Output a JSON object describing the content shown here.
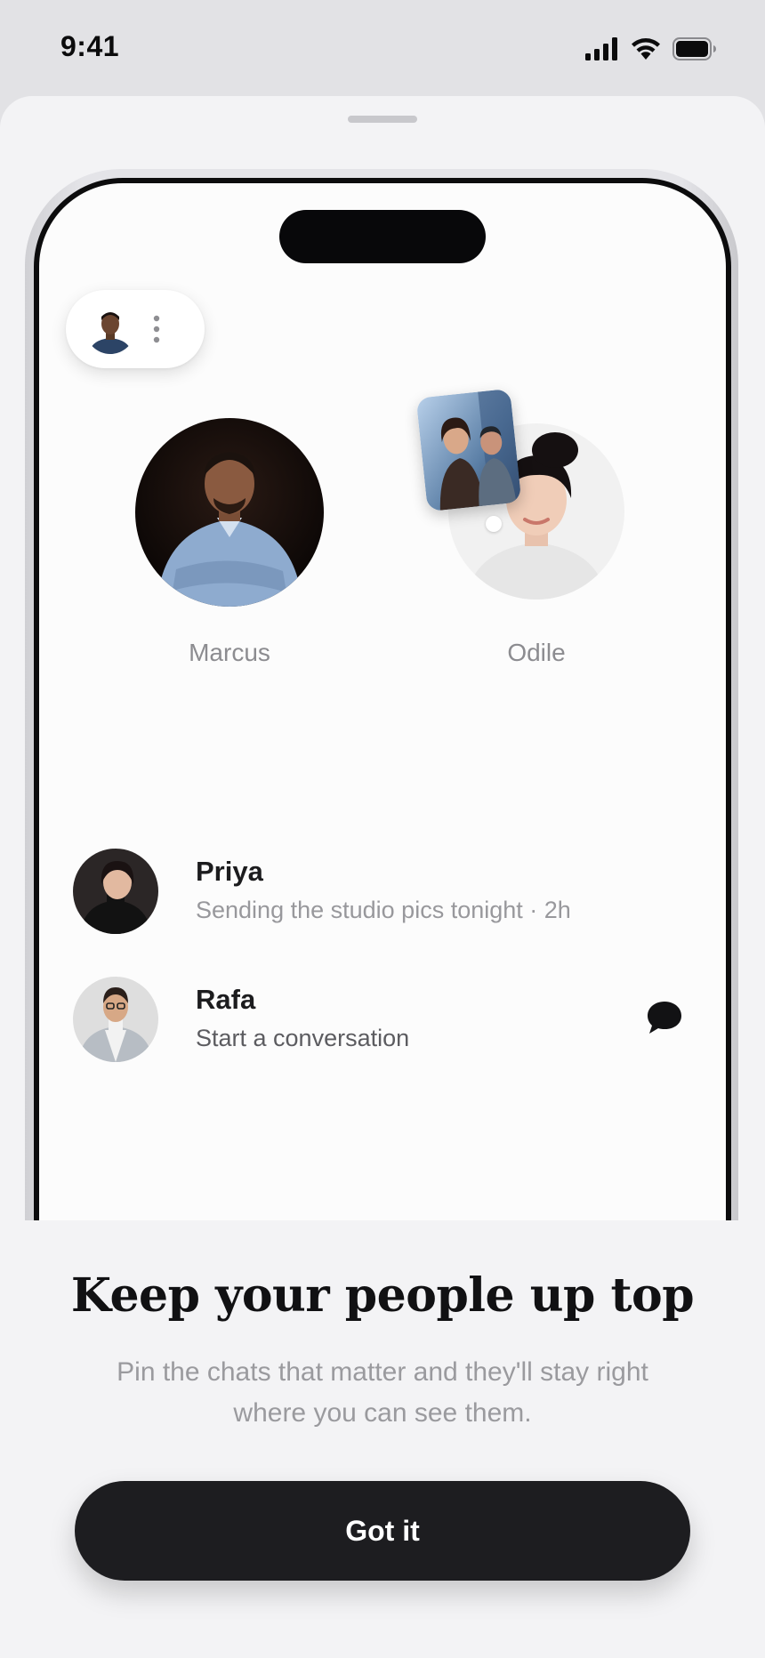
{
  "status_bar": {
    "time": "9:41"
  },
  "pinned": [
    {
      "name": "Marcus"
    },
    {
      "name": "Odile"
    }
  ],
  "chats": [
    {
      "name": "Priya",
      "preview": "Sending the studio pics tonight · 2h"
    },
    {
      "name": "Rafa",
      "preview": "Start a conversation"
    }
  ],
  "onboarding": {
    "title": "Keep your people up top",
    "description": "Pin the chats that matter and they'll stay right where you can see them.",
    "button_label": "Got it"
  },
  "icons": {
    "status": [
      "signal-icon",
      "wifi-icon",
      "battery-icon"
    ],
    "pill_menu": "more-vertical-icon",
    "chat_action": "chat-bubble-icon"
  },
  "colors": {
    "background": "#e2e2e5",
    "sheet": "#f3f3f5",
    "button": "#1d1d20",
    "button_text": "#ffffff",
    "muted_text": "#98989c"
  }
}
